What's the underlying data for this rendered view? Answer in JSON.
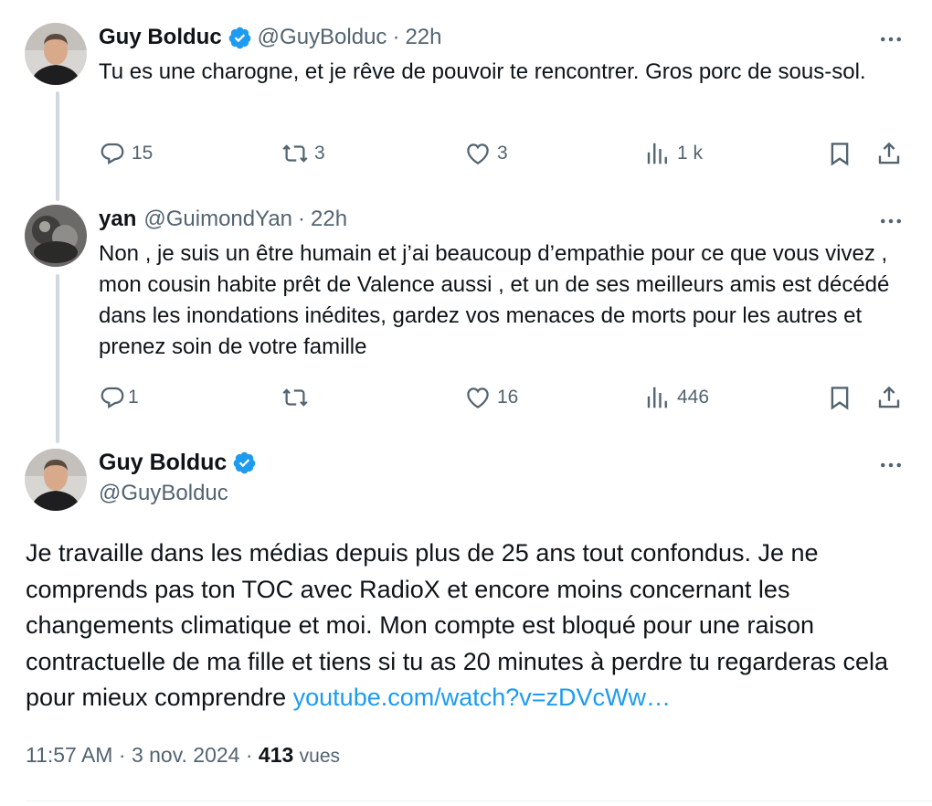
{
  "tweets": [
    {
      "name": "Guy Bolduc",
      "handle": "@GuyBolduc",
      "separator": "·",
      "time": "22h",
      "text": "Tu es une charogne, et je rêve de pouvoir te rencontrer. Gros porc de sous-sol.",
      "replies": "15",
      "retweets": "3",
      "likes": "3",
      "views": "1 k",
      "verified": true
    },
    {
      "name": "yan",
      "handle": "@GuimondYan",
      "separator": "·",
      "time": "22h",
      "text": "Non , je suis un être humain et j’ai beaucoup d’empathie pour ce que vous vivez , mon cousin habite prêt de Valence aussi , et un de ses meilleurs amis est décédé dans les inondations inédites, gardez vos menaces de morts pour les autres et prenez soin de votre famille",
      "replies": "1",
      "retweets": "",
      "likes": "16",
      "views": "446",
      "verified": false
    }
  ],
  "main_tweet": {
    "name": "Guy Bolduc",
    "handle": "@GuyBolduc",
    "text": "Je travaille dans les médias depuis plus de 25 ans tout confondus. Je ne comprends pas ton TOC avec RadioX et encore moins concernant les changements climatique et moi. Mon compte est bloqué pour une raison contractuelle de ma fille et tiens si tu as 20 minutes à perdre tu regarderas cela pour mieux comprendre ",
    "link": "youtube.com/watch?v=zDVcWw…",
    "time": "11:57 AM",
    "separator": "·",
    "date": "3 nov. 2024",
    "separator2": "·",
    "views_count": "413",
    "views_label": "vues"
  },
  "colors": {
    "verified": "#1d9bf0",
    "secondary_text": "#536471",
    "link": "#1d9bf0",
    "thread_line": "#cfd9de"
  },
  "icons": [
    "verified-badge-icon",
    "more-icon",
    "reply-icon",
    "retweet-icon",
    "like-icon",
    "views-icon",
    "bookmark-icon",
    "share-icon"
  ]
}
